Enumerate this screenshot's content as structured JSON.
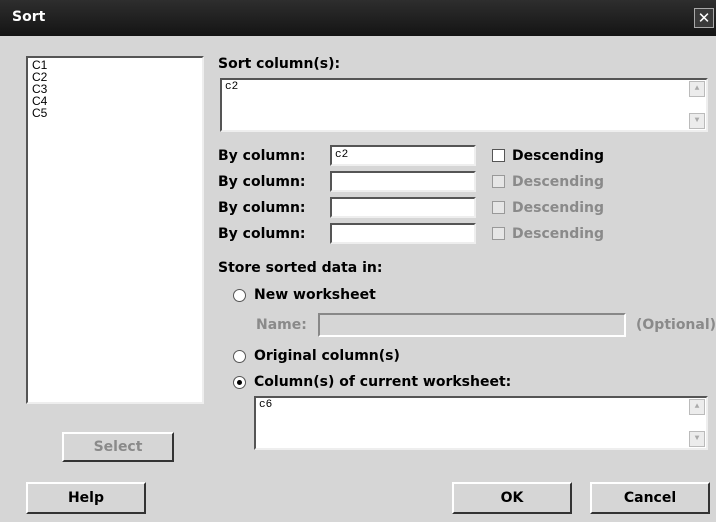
{
  "window": {
    "title": "Sort",
    "close_glyph": "✕"
  },
  "columns_list": [
    "C1",
    "C2",
    "C3",
    "C4",
    "C5"
  ],
  "select_button": "Select",
  "sort_columns": {
    "label": "Sort column(s):",
    "value": "c2"
  },
  "by_columns": [
    {
      "label": "By column:",
      "value": "c2",
      "descending_label": "Descending",
      "enabled": true
    },
    {
      "label": "By column:",
      "value": "",
      "descending_label": "Descending",
      "enabled": false
    },
    {
      "label": "By column:",
      "value": "",
      "descending_label": "Descending",
      "enabled": false
    },
    {
      "label": "By column:",
      "value": "",
      "descending_label": "Descending",
      "enabled": false
    }
  ],
  "store": {
    "label": "Store sorted data in:",
    "new_worksheet": "New worksheet",
    "name_label": "Name:",
    "name_value": "",
    "optional": "(Optional)",
    "original_columns": "Original column(s)",
    "current_worksheet": "Column(s) of current worksheet:",
    "current_worksheet_value": "c6",
    "selected": "current_worksheet"
  },
  "buttons": {
    "help": "Help",
    "ok": "OK",
    "cancel": "Cancel"
  }
}
